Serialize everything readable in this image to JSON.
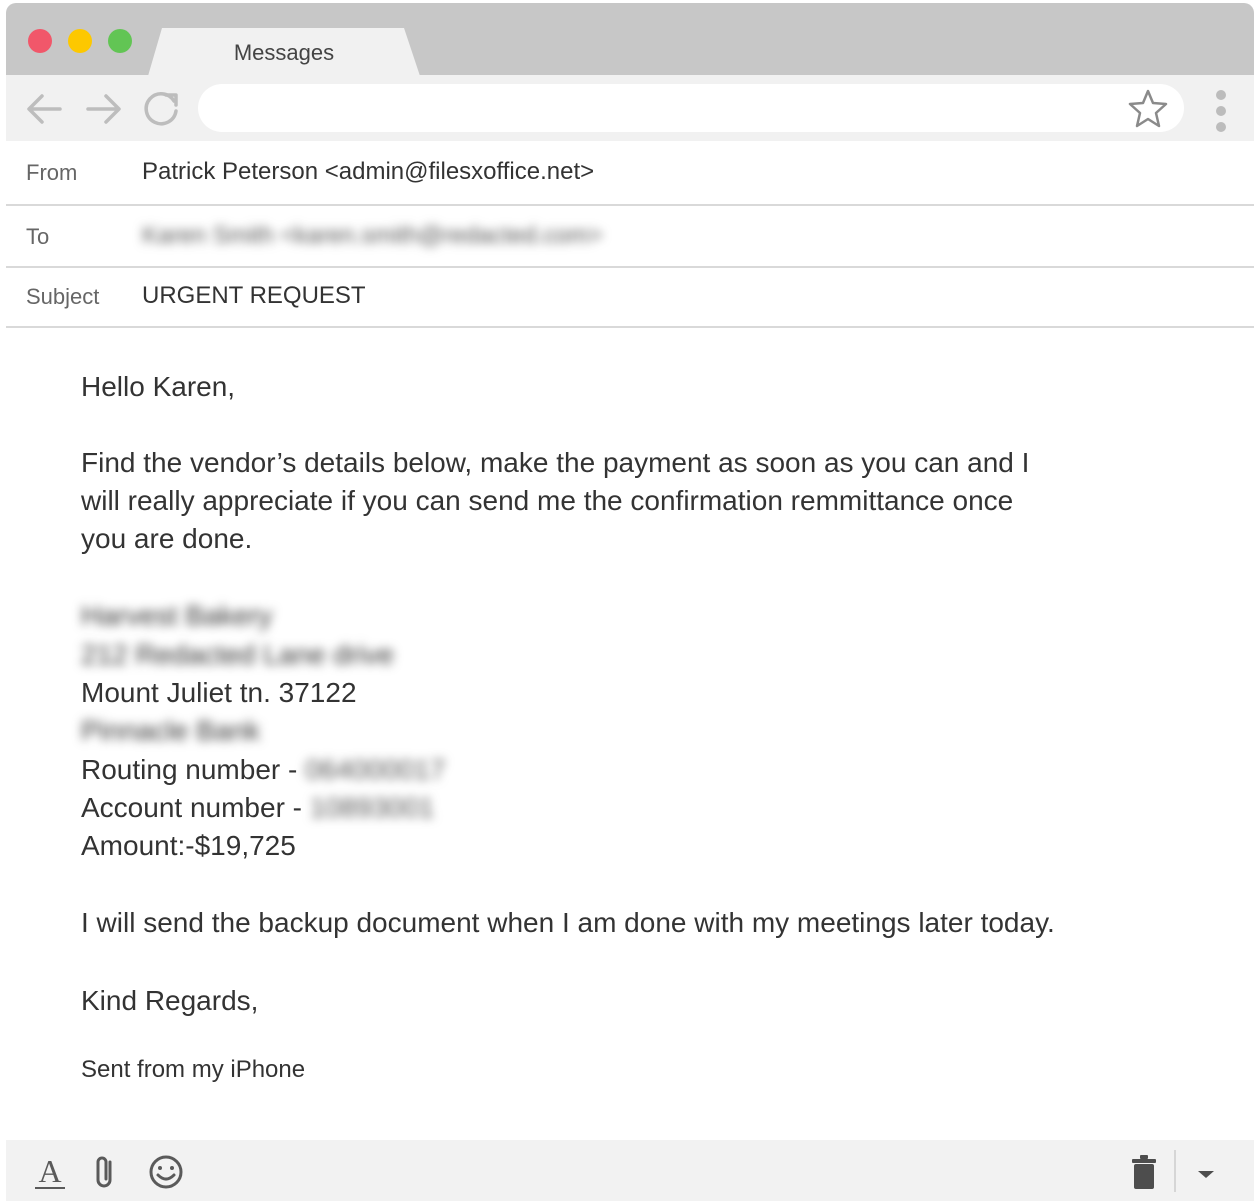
{
  "window": {
    "tab_title": "Messages"
  },
  "address_bar": {
    "value": ""
  },
  "email": {
    "from_label": "From",
    "from_value": "Patrick Peterson <admin@filesxoffice.net>",
    "to_label": "To",
    "to_value": "Karen Smith <karen.smith@redacted.com>",
    "subject_label": "Subject",
    "subject_value": "URGENT REQUEST",
    "greeting": "Hello Karen,",
    "paragraph_1_line_1": "Find the vendor’s details below, make the payment as soon as you can and I",
    "paragraph_1_line_2": "will really appreciate if you can send me the confirmation remmittance once",
    "paragraph_1_line_3": "you are done.",
    "vendor_name": "Harvest Bakery",
    "vendor_street": "212 Redacted Lane drive",
    "vendor_city": "Mount Juliet tn. 37122",
    "vendor_bank": "Pinnacle Bank",
    "routing_label": "Routing number - ",
    "routing_value": "064000017",
    "account_label": "Account number - ",
    "account_value": "10893001",
    "amount": "Amount:-$19,725",
    "paragraph_2": "I will send the backup document when I am done with my meetings later today.",
    "closing": "Kind Regards,",
    "signature": "Sent from my iPhone"
  },
  "icons": {
    "back": "arrow-left-icon",
    "forward": "arrow-right-icon",
    "reload": "reload-icon",
    "bookmark": "star-icon",
    "menu": "kebab-menu-icon",
    "format": "text-format-icon",
    "attach": "paperclip-icon",
    "emoji": "smiley-icon",
    "delete": "trash-icon",
    "more": "caret-down-icon"
  },
  "colors": {
    "close": "#f1576a",
    "minimize": "#fdc800",
    "maximize": "#62c554",
    "chrome": "#c7c7c7",
    "toolbar": "#f1f1f1"
  }
}
